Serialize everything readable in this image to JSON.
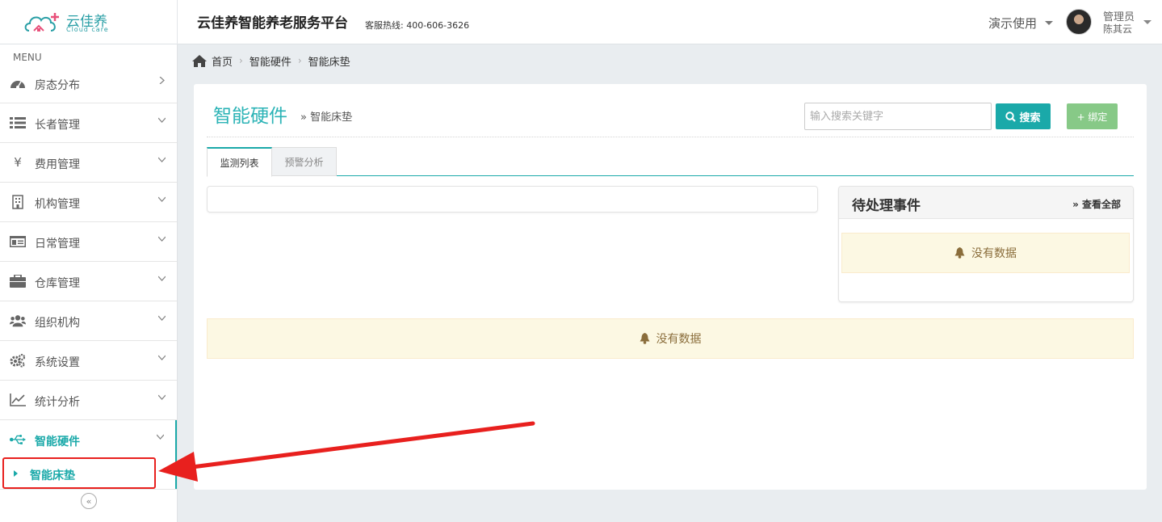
{
  "header": {
    "logo_cn": "云佳养",
    "logo_en": "Cloud care",
    "title": "云佳养智能养老服务平台",
    "hotline": "客服热线: 400-606-3626",
    "demo_menu": "演示使用",
    "user_role": "管理员",
    "user_name": "陈其云"
  },
  "sidebar": {
    "menu_label": "MENU",
    "items": [
      {
        "label": "房态分布",
        "icon": "dashboard-icon"
      },
      {
        "label": "长者管理",
        "icon": "list-icon"
      },
      {
        "label": "费用管理",
        "icon": "yen-icon"
      },
      {
        "label": "机构管理",
        "icon": "building-icon"
      },
      {
        "label": "日常管理",
        "icon": "id-card-icon"
      },
      {
        "label": "仓库管理",
        "icon": "briefcase-icon"
      },
      {
        "label": "组织机构",
        "icon": "users-icon"
      },
      {
        "label": "系统设置",
        "icon": "gears-icon"
      },
      {
        "label": "统计分析",
        "icon": "line-chart-icon"
      },
      {
        "label": "智能硬件",
        "icon": "usb-icon"
      }
    ],
    "sub_item": "智能床垫"
  },
  "breadcrumb": {
    "home": "首页",
    "level1": "智能硬件",
    "level2": "智能床垫"
  },
  "page": {
    "title": "智能硬件",
    "subtitle": "» 智能床垫",
    "search_placeholder": "输入搜索关键字",
    "search_button": "搜索",
    "bind_button": "+ 绑定",
    "tabs": [
      "监测列表",
      "预警分析"
    ],
    "pending": {
      "title": "待处理事件",
      "view_all": "» 查看全部",
      "empty": "没有数据"
    },
    "empty_main": "没有数据"
  },
  "colors": {
    "accent": "#1aa9a9",
    "bind_button": "#87c987",
    "annotation_red": "#e8201e",
    "notice_bg": "#fcf8e3"
  }
}
